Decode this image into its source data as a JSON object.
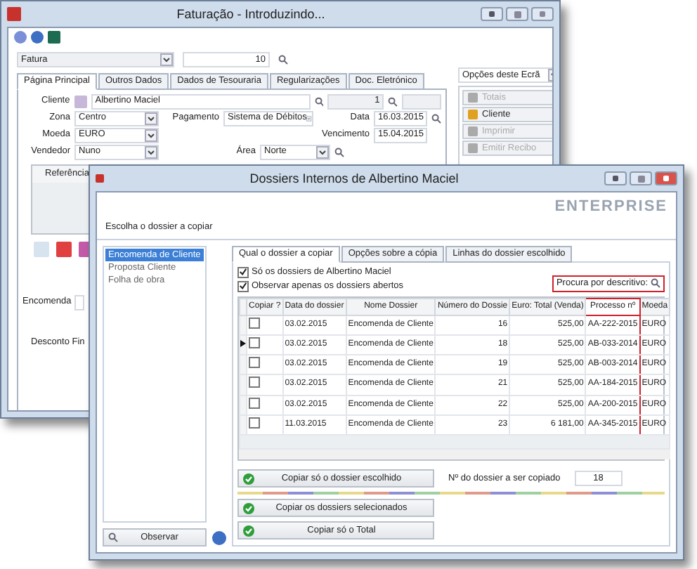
{
  "main_window": {
    "title": "Faturação - Introduzindo...",
    "document_type": "Fatura",
    "document_number": "10",
    "tabs": [
      {
        "label": "Página Principal",
        "selected": true
      },
      {
        "label": "Outros Dados",
        "selected": false
      },
      {
        "label": "Dados de Tesouraria",
        "selected": false
      },
      {
        "label": "Regularizações",
        "selected": false
      },
      {
        "label": "Doc. Eletrónico",
        "selected": false
      }
    ],
    "client": {
      "label": "Cliente",
      "value": "Albertino Maciel",
      "number": "1"
    },
    "zone": {
      "label": "Zona",
      "value": "Centro"
    },
    "payment": {
      "label": "Pagamento",
      "value": "Sistema de Débitos"
    },
    "date": {
      "label": "Data",
      "value": "16.03.2015"
    },
    "currency": {
      "label": "Moeda",
      "value": "EURO"
    },
    "due_date": {
      "label": "Vencimento",
      "value": "15.04.2015"
    },
    "seller": {
      "label": "Vendedor",
      "value": "Nuno"
    },
    "area": {
      "label": "Área",
      "value": "Norte"
    },
    "grid_column": "Referência",
    "order_label": "Encomenda",
    "discount_label": "Desconto Fin",
    "options_panel": {
      "title": "Opções deste Ecrã",
      "buttons": [
        {
          "label": "Totais",
          "disabled": true
        },
        {
          "label": "Cliente",
          "disabled": false
        },
        {
          "label": "Imprimir",
          "disabled": true
        },
        {
          "label": "Emitir Recibo",
          "disabled": true
        }
      ]
    }
  },
  "dialog": {
    "title": "Dossiers Internos de Albertino Maciel",
    "logo": "ENTERPRISE",
    "prompt": "Escolha o dossier a copiar",
    "dossier_types": [
      {
        "label": "Encomenda de Cliente",
        "selected": true
      },
      {
        "label": "Proposta Cliente",
        "selected": false
      },
      {
        "label": "Folha de obra",
        "selected": false
      }
    ],
    "tabs": [
      {
        "label": "Qual o dossier a copiar",
        "selected": true
      },
      {
        "label": "Opções sobre a cópia",
        "selected": false
      },
      {
        "label": "Linhas do dossier escolhido",
        "selected": false
      }
    ],
    "options": [
      {
        "label": "Só os dossiers de Albertino Maciel",
        "checked": true
      },
      {
        "label": "Observar apenas os dossiers abertos",
        "checked": true
      }
    ],
    "search": {
      "label": "Procura por descritivo:",
      "highlighted": true
    },
    "table": {
      "columns": [
        {
          "label": "Copiar ?",
          "highlighted": false
        },
        {
          "label": "Data do dossier",
          "highlighted": false
        },
        {
          "label": "Nome Dossier",
          "highlighted": false
        },
        {
          "label": "Número do Dossie",
          "highlighted": false
        },
        {
          "label": "Euro: Total (Venda)",
          "highlighted": false
        },
        {
          "label": "Processo nº",
          "highlighted": true
        },
        {
          "label": "Moeda",
          "highlighted": false
        }
      ],
      "rows": [
        {
          "current": false,
          "copy": false,
          "cells": [
            "",
            "03.02.2015",
            "Encomenda de Cliente",
            "16",
            "525,00",
            "AA-222-2015",
            "EURO"
          ]
        },
        {
          "current": true,
          "copy": false,
          "cells": [
            "",
            "03.02.2015",
            "Encomenda de Cliente",
            "18",
            "525,00",
            "AB-033-2014",
            "EURO"
          ]
        },
        {
          "current": false,
          "copy": false,
          "cells": [
            "",
            "03.02.2015",
            "Encomenda de Cliente",
            "19",
            "525,00",
            "AB-003-2014",
            "EURO"
          ]
        },
        {
          "current": false,
          "copy": false,
          "cells": [
            "",
            "03.02.2015",
            "Encomenda de Cliente",
            "21",
            "525,00",
            "AA-184-2015",
            "EURO"
          ]
        },
        {
          "current": false,
          "copy": false,
          "cells": [
            "",
            "03.02.2015",
            "Encomenda de Cliente",
            "22",
            "525,00",
            "AA-200-2015",
            "EURO"
          ]
        },
        {
          "current": false,
          "copy": false,
          "cells": [
            "",
            "11.03.2015",
            "Encomenda de Cliente",
            "23",
            "6 181,00",
            "AA-345-2015",
            "EURO"
          ]
        }
      ]
    },
    "copy_chosen_button": "Copiar só o dossier escolhido",
    "chosen_label": "Nº do dossier a ser copiado",
    "chosen_number": "18",
    "copy_selected_button": "Copiar os dossiers selecionados",
    "copy_total_button": "Copiar só o Total",
    "observe_button": "Observar"
  }
}
